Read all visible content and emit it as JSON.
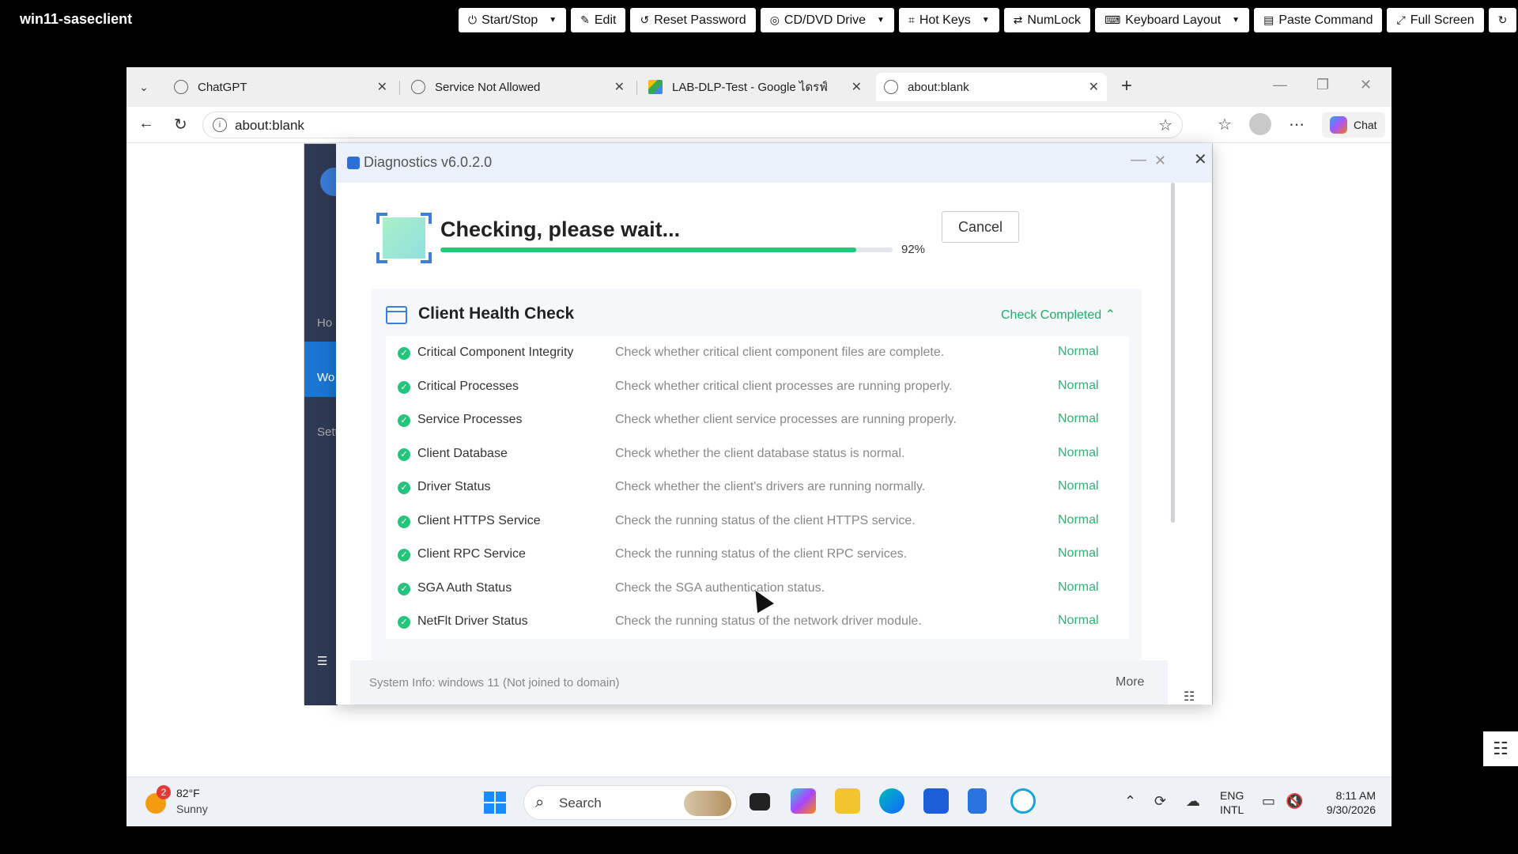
{
  "remote": {
    "title": "win11-saseclient",
    "buttons": [
      {
        "label": "Start/Stop",
        "icon": "⏻",
        "caret": true
      },
      {
        "label": "Edit",
        "icon": "✎",
        "caret": false
      },
      {
        "label": "Reset Password",
        "icon": "↺",
        "caret": false
      },
      {
        "label": "CD/DVD Drive",
        "icon": "◎",
        "caret": true
      },
      {
        "label": "Hot Keys",
        "icon": "⌗",
        "caret": true
      },
      {
        "label": "NumLock",
        "icon": "⇄",
        "caret": false
      },
      {
        "label": "Keyboard Layout",
        "icon": "⌨",
        "caret": true
      },
      {
        "label": "Paste Command",
        "icon": "▤",
        "caret": false
      },
      {
        "label": "Full Screen",
        "icon": "⤢",
        "caret": false
      }
    ]
  },
  "browser": {
    "tabs": [
      {
        "title": "ChatGPT"
      },
      {
        "title": "Service Not Allowed"
      },
      {
        "title": "LAB-DLP-Test - Google ไดรฟ์"
      },
      {
        "title": "about:blank"
      }
    ],
    "url": "about:blank",
    "chat_label": "Chat"
  },
  "bgapp": {
    "labels": [
      "Ho",
      "Wo",
      "Setti"
    ]
  },
  "dialog": {
    "title": "Diagnostics v6.0.2.0",
    "checking_text": "Checking, please wait...",
    "progress_percent": 92,
    "progress_label": "92%",
    "cancel_label": "Cancel",
    "section_title": "Client Health Check",
    "section_status": "Check Completed",
    "rows": [
      {
        "name": "Critical Component Integrity",
        "desc": "Check whether critical client component files are complete.",
        "status": "Normal"
      },
      {
        "name": "Critical Processes",
        "desc": "Check whether critical client processes are running properly.",
        "status": "Normal"
      },
      {
        "name": "Service Processes",
        "desc": "Check whether client service processes are running properly.",
        "status": "Normal"
      },
      {
        "name": "Client Database",
        "desc": "Check whether the client database status is normal.",
        "status": "Normal"
      },
      {
        "name": "Driver Status",
        "desc": "Check whether the client's drivers are running normally.",
        "status": "Normal"
      },
      {
        "name": "Client HTTPS Service",
        "desc": "Check the running status of the client HTTPS service.",
        "status": "Normal"
      },
      {
        "name": "Client RPC Service",
        "desc": "Check the running status of the client RPC services.",
        "status": "Normal"
      },
      {
        "name": "SGA Auth Status",
        "desc": "Check the SGA authentication status.",
        "status": "Normal"
      },
      {
        "name": "NetFlt Driver Status",
        "desc": "Check the running status of the network driver module.",
        "status": "Normal"
      }
    ],
    "system_info": "System Info: windows 11 (Not joined to domain)",
    "more_label": "More"
  },
  "taskbar": {
    "weather_badge": "2",
    "temperature": "82°F",
    "condition": "Sunny",
    "search_label": "Search",
    "lang_line1": "ENG",
    "lang_line2": "INTL",
    "time": "8:11 AM",
    "date": "9/30/2026"
  },
  "colors": {
    "accent_green": "#20c97a",
    "status_green": "#2bb673",
    "brand_blue": "#2c6fd6"
  }
}
